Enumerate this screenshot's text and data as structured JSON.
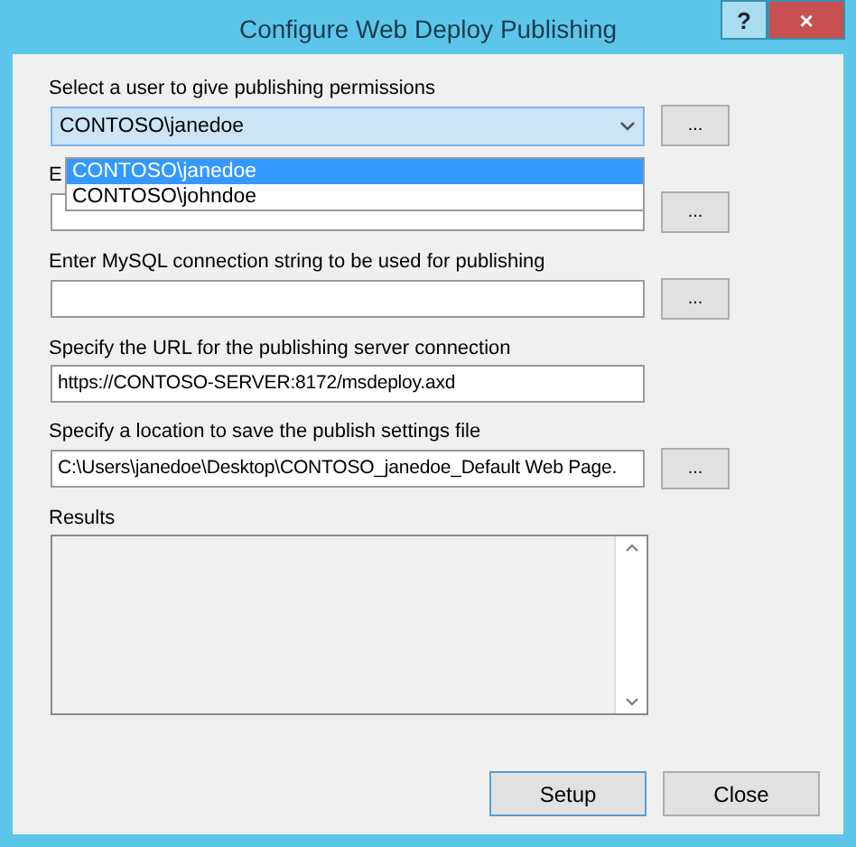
{
  "window": {
    "title": "Configure Web Deploy Publishing",
    "help_button": "?",
    "close_button": "×"
  },
  "user_select": {
    "label": "Select a user to give publishing permissions",
    "value": "CONTOSO\\janedoe",
    "browse_button": "...",
    "expanded": true,
    "options": [
      {
        "label": "CONTOSO\\janedoe",
        "selected": true
      },
      {
        "label": "CONTOSO\\johndoe",
        "selected": false
      }
    ]
  },
  "fields": [
    {
      "label": "E",
      "browse_button": "..."
    },
    {
      "label": "Enter MySQL connection string to be used for publishing",
      "browse_button": "..."
    },
    {
      "label": "Specify the URL for the publishing server connection",
      "value": "https://CONTOSO-SERVER:8172/msdeploy.axd"
    },
    {
      "label": "Specify a location to save the publish settings file",
      "value": "C:\\Users\\janedoe\\Desktop\\CONTOSO_janedoe_Default Web Page.",
      "browse_button": "..."
    }
  ],
  "results": {
    "label": "Results"
  },
  "buttons": [
    "Setup",
    "Close"
  ]
}
